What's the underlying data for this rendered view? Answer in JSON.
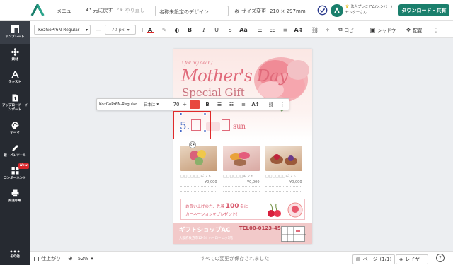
{
  "header": {
    "menu_label": "メニュー",
    "undo_label": "元に戻す",
    "redo_label": "やり直し",
    "design_title": "名称未設定のデザイン",
    "size_label": "サイズ変更",
    "size_value": "210 × 297mm",
    "user_plan": "法人プレミアム(メンバー)",
    "user_name": "センターさん",
    "download_label": "ダウンロード・共有"
  },
  "toolbar": {
    "font_family": "KozGoPr6N-Regular",
    "font_size": "70 px",
    "copy_label": "コピー",
    "shadow_label": "シャドウ",
    "arrange_label": "配置"
  },
  "sidebar": {
    "items": [
      {
        "label": "テンプレート",
        "icon": "template-icon"
      },
      {
        "label": "素材",
        "icon": "material-icon"
      },
      {
        "label": "テキスト",
        "icon": "text-icon"
      },
      {
        "label": "アップロード・インポート",
        "icon": "upload-icon"
      },
      {
        "label": "テーマ",
        "icon": "theme-icon"
      },
      {
        "label": "線・ペンツール",
        "icon": "pen-icon"
      },
      {
        "label": "コンポーネント",
        "icon": "component-icon",
        "badge": "New"
      },
      {
        "label": "発注印刷",
        "icon": "printer-icon"
      }
    ],
    "more_label": "その他"
  },
  "floating_toolbar": {
    "font_family": "KozGoPr6N-Regular",
    "language": "日本に",
    "font_size": "70",
    "color": "#e8473f"
  },
  "poster": {
    "tagline": "for my dear",
    "title_line1": "Mother's Day",
    "title_line2": "Special Gift",
    "date_partial_1": "5.",
    "date_partial_2": "sun",
    "products": [
      {
        "name": "□□□□□□ギフト",
        "price": "¥0,000"
      },
      {
        "name": "□□□□□□ギフト",
        "price": "¥0,000"
      },
      {
        "name": "□□□□□□ギフト",
        "price": "¥0,000"
      }
    ],
    "banner_line1": "お買い上げの方、先着",
    "banner_number": "100",
    "banner_unit": "名に",
    "banner_line2": "カーネーションをプレゼント！",
    "shop_name": "ギフトショップAC",
    "shop_tel": "TEL00-0123-4567",
    "shop_address": "大阪府枚方市12-34 ホーローにホ1階"
  },
  "footer": {
    "finish_label": "仕上がり",
    "zoom": "52%",
    "save_status": "すべての変更が保存されました",
    "page_label": "ページ",
    "page_count": "(1/1)",
    "layer_label": "レイヤー"
  },
  "colors": {
    "accent": "#1a7f6c",
    "sidebar_bg": "#262a31",
    "poster_pink": "#e06a7a",
    "selection_red": "#e02a2a",
    "handle_blue": "#3b5fc4"
  }
}
